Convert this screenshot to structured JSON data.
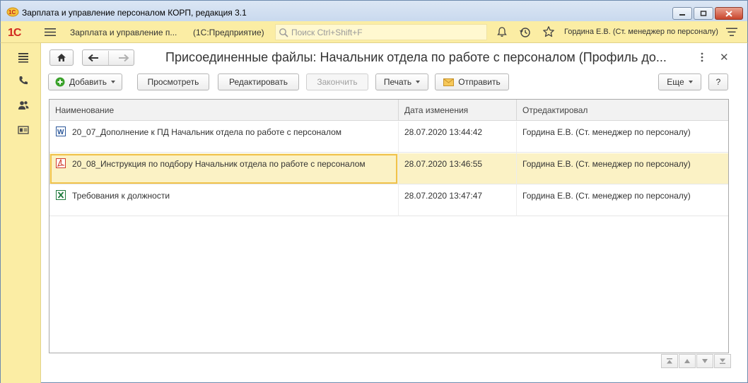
{
  "window": {
    "title": "Зарплата и управление персоналом КОРП, редакция 3.1"
  },
  "appbar": {
    "logo": "1С",
    "app_name": "Зарплата и управление п...",
    "app_sub": "(1С:Предприятие)",
    "search_placeholder": "Поиск Ctrl+Shift+F",
    "user": "Гордина Е.В. (Ст. менеджер по персоналу)"
  },
  "form": {
    "title": "Присоединенные файлы: Начальник отдела по работе с персоналом (Профиль до..."
  },
  "toolbar": {
    "add_label": "Добавить",
    "view_label": "Просмотреть",
    "edit_label": "Редактировать",
    "finish_label": "Закончить",
    "print_label": "Печать",
    "send_label": "Отправить",
    "more_label": "Еще",
    "help_label": "?"
  },
  "table": {
    "columns": [
      "Наименование",
      "Дата изменения",
      "Отредактировал"
    ],
    "rows": [
      {
        "icon": "word-file-icon",
        "name": "20_07_Дополнение к ПД Начальник отдела по работе с персоналом",
        "date": "28.07.2020 13:44:42",
        "editor": "Гордина Е.В. (Ст. менеджер по персоналу)"
      },
      {
        "icon": "pdf-file-icon",
        "name": "20_08_Инструкция по подбору Начальник отдела по работе с персоналом",
        "date": "28.07.2020 13:46:55",
        "editor": "Гордина Е.В. (Ст. менеджер по персоналу)"
      },
      {
        "icon": "excel-file-icon",
        "name": "Требования к должности",
        "date": "28.07.2020 13:47:47",
        "editor": "Гордина Е.В. (Ст. менеджер по персоналу)"
      }
    ],
    "selected_row": 1
  },
  "colors": {
    "panel": "#fbeda4",
    "selection": "#fbf2c5",
    "accent": "#f0c24a",
    "logo_red": "#d12a20"
  }
}
